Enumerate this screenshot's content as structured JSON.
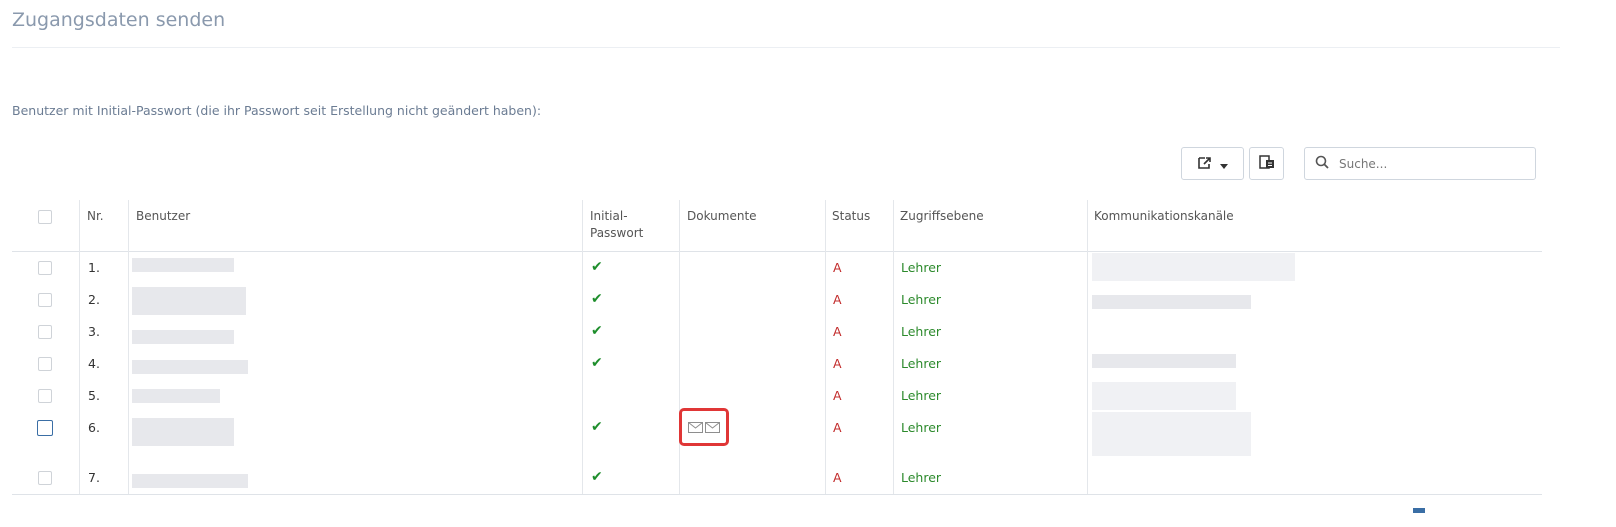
{
  "page": {
    "title": "Zugangsdaten senden",
    "subtitle": "Benutzer mit Initial-Passwort (die ihr Passwort seit Erstellung nicht geändert haben):"
  },
  "toolbar": {
    "export_icon": "export-icon",
    "columns_icon": "columns-icon",
    "search_placeholder": "Suche..."
  },
  "table": {
    "headers": {
      "nr": "Nr.",
      "benutzer": "Benutzer",
      "initial_line1": "Initial-",
      "initial_line2": "Passwort",
      "dokumente": "Dokumente",
      "status": "Status",
      "zugriffsebene": "Zugriffsebene",
      "kanaele": "Kommunikationskanäle"
    },
    "rows": [
      {
        "nr": "1.",
        "initial": "✔",
        "status": "A",
        "level": "Lehrer"
      },
      {
        "nr": "2.",
        "initial": "✔",
        "status": "A",
        "level": "Lehrer"
      },
      {
        "nr": "3.",
        "initial": "✔",
        "status": "A",
        "level": "Lehrer"
      },
      {
        "nr": "4.",
        "initial": "✔",
        "status": "A",
        "level": "Lehrer"
      },
      {
        "nr": "5.",
        "initial": "",
        "status": "A",
        "level": "Lehrer"
      },
      {
        "nr": "6.",
        "initial": "✔",
        "status": "A",
        "level": "Lehrer",
        "documents": [
          "envelope-icon",
          "envelope-icon"
        ]
      },
      {
        "nr": "7.",
        "initial": "✔",
        "status": "A",
        "level": "Lehrer"
      }
    ]
  },
  "colors": {
    "check": "#1e8e2c",
    "status": "#c22b2b",
    "level": "#2c8a2c",
    "highlight": "#e03636"
  }
}
